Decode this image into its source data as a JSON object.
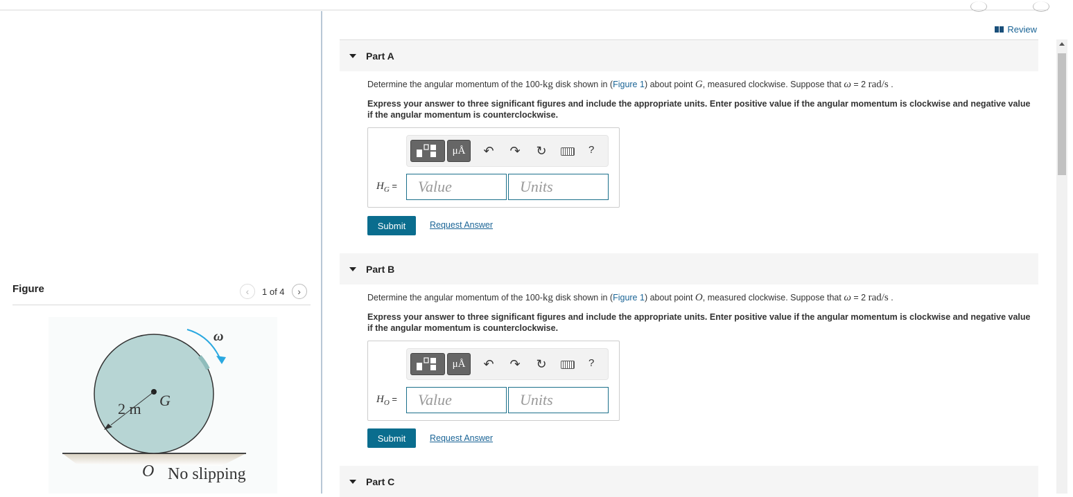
{
  "figure_panel": {
    "title": "Figure",
    "counter": "1 of 4",
    "prev_icon": "chevron-left-icon",
    "next_icon": "chevron-right-icon",
    "diagram": {
      "omega_label": "ω",
      "center_label": "G",
      "radius_label": "2 m",
      "contact_label": "O",
      "ground_label": "No slipping",
      "disk_color": "#b7d5d4",
      "arrow_color": "#2aa8e0"
    }
  },
  "review": {
    "label": "Review",
    "icon": "book-icon"
  },
  "parts": [
    {
      "label": "Part A",
      "question": {
        "pre": "Determine the angular momentum of the 100-",
        "unit_kg": "kg",
        "mid1": " disk shown in (",
        "figure_link": "Figure 1",
        "mid2": ") about point ",
        "point": "G",
        "mid3": ", measured clockwise. Suppose that ",
        "omega": "ω",
        "mid4": " = 2  ",
        "rad": "rad/s",
        "end": " ."
      },
      "instructions": "Express your answer to three significant figures and include the appropriate units. Enter positive value if the angular momentum is clockwise and negative value if the angular momentum is counterclockwise.",
      "var_symbol": "H",
      "var_sub": "G",
      "equals": " =",
      "value_placeholder": "Value",
      "units_placeholder": "Units",
      "submit_label": "Submit",
      "request_label": "Request Answer"
    },
    {
      "label": "Part B",
      "question": {
        "pre": "Determine the angular momentum of the 100-",
        "unit_kg": "kg",
        "mid1": " disk shown in (",
        "figure_link": "Figure 1",
        "mid2": ") about point ",
        "point": "O",
        "mid3": ", measured clockwise. Suppose that ",
        "omega": "ω",
        "mid4": " = 2  ",
        "rad": "rad/s",
        "end": " ."
      },
      "instructions": "Express your answer to three significant figures and include the appropriate units. Enter positive value if the angular momentum is clockwise and negative value if the angular momentum is counterclockwise.",
      "var_symbol": "H",
      "var_sub": "O",
      "equals": " =",
      "value_placeholder": "Value",
      "units_placeholder": "Units",
      "submit_label": "Submit",
      "request_label": "Request Answer"
    },
    {
      "label": "Part C"
    }
  ],
  "toolbar": {
    "template_icon": "templates-icon",
    "symbol_label": "μÅ",
    "undo_icon": "undo-icon",
    "redo_icon": "redo-icon",
    "reset_icon": "reset-icon",
    "keyboard_icon": "keyboard-icon",
    "help_label": "?"
  }
}
